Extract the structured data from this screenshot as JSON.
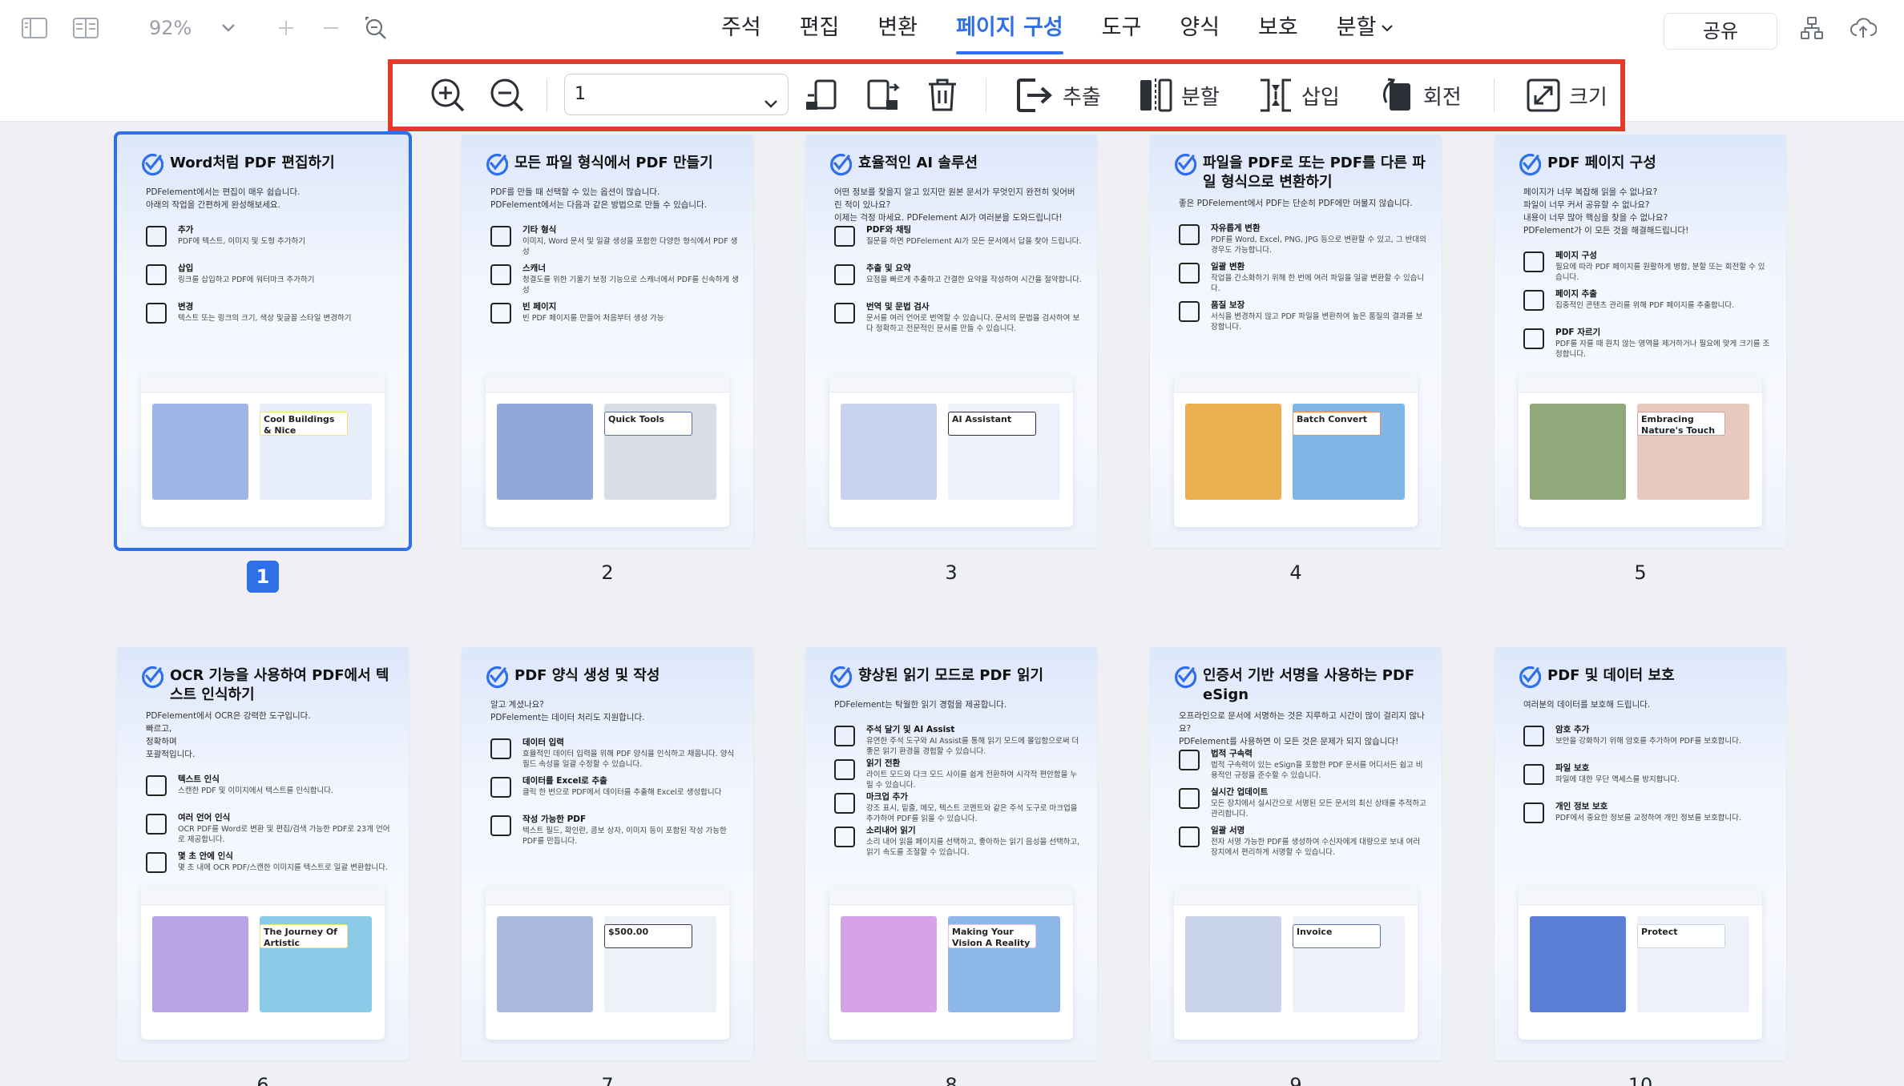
{
  "header": {
    "zoom": "92%",
    "menu": [
      {
        "label": "주석"
      },
      {
        "label": "편집"
      },
      {
        "label": "변환"
      },
      {
        "label": "페이지 구성"
      },
      {
        "label": "도구"
      },
      {
        "label": "양식"
      },
      {
        "label": "보호"
      },
      {
        "label": "분할"
      }
    ],
    "active_menu": "페이지 구성",
    "share_label": "공유"
  },
  "toolbar": {
    "page_value": "1",
    "extract_label": "추출",
    "split_label": "분할",
    "insert_label": "삽입",
    "rotate_label": "회전",
    "size_label": "크기"
  },
  "pages": [
    {
      "number": "1",
      "selected": true,
      "title": "Word처럼 PDF 편집하기",
      "intro": "PDFelement에서는 편집이 매우 쉽습니다.\n아래의 작업을 간편하게 완성해보세요.",
      "features": [
        {
          "name": "추가",
          "desc": "PDF에 텍스트, 이미지 및 도형 추가하기"
        },
        {
          "name": "삽입",
          "desc": "링크를 삽입하고 PDF에 워터마크 추가하기"
        },
        {
          "name": "변경",
          "desc": "텍스트 또는 링크의 크기, 색상 및글꼴 스타일 변경하기"
        }
      ],
      "mock_text": "Cool Buildings & Nice Gradients"
    },
    {
      "number": "2",
      "selected": false,
      "title": "모든 파일 형식에서 PDF 만들기",
      "intro": "PDF를 만들 때 선택할 수 있는 옵션이 많습니다.\nPDFelement에서는 다음과 같은 방법으로 만들 수 있습니다.",
      "features": [
        {
          "name": "기타 형식",
          "desc": "이미지, Word 문서 및 일괄 생성을 포함한 다양한 형식에서 PDF 생성"
        },
        {
          "name": "스캐너",
          "desc": "청결도를 위한 기울기 보정 기능으로 스캐너에서 PDF를 신속하게 생성"
        },
        {
          "name": "빈 페이지",
          "desc": "빈 PDF 페이지를 만들어 처음부터 생성 가능"
        }
      ],
      "mock_text": "Quick Tools"
    },
    {
      "number": "3",
      "selected": false,
      "title": "효율적인 AI 솔루션",
      "intro": "어떤 정보를 찾을지 알고 있지만 원본 문서가 무엇인지 완전히 잊어버린 적이 있나요?\n이제는 걱정 마세요. PDFelement AI가 여러분을 도와드립니다!",
      "features": [
        {
          "name": "PDF와 채팅",
          "desc": "질문을 하면 PDFelement AI가 모든 문서에서 답을 찾아 드립니다."
        },
        {
          "name": "추출 및 요약",
          "desc": "요점을 빠르게 추출하고 간결한 요약을 작성하여 시간을 절약합니다."
        },
        {
          "name": "번역 및 문법 검사",
          "desc": "문서를 여러 언어로 번역할 수 있습니다. 문서의 문법을 검사하여 보다 정확하고 전문적인 문서를 만들 수 있습니다."
        }
      ],
      "mock_text": "AI Assistant"
    },
    {
      "number": "4",
      "selected": false,
      "title": "파일을 PDF로 또는 PDF를 다른 파일 형식으로 변환하기",
      "intro": "좋은 PDFelement에서 PDF는 단순히 PDF에만 머물지 않습니다.",
      "features": [
        {
          "name": "자유롭게 변환",
          "desc": "PDF를 Word, Excel, PNG, JPG 등으로 변환할 수 있고, 그 반대의 경우도 가능합니다."
        },
        {
          "name": "일괄 변환",
          "desc": "작업을 간소화하기 위해 한 번에 여러 파일을 일괄 변환할 수 있습니다."
        },
        {
          "name": "품질 보장",
          "desc": "서식을 변경하지 않고 PDF 파일을 변환하여 높은 품질의 결과를 보장합니다."
        }
      ],
      "mock_text": "Batch Convert"
    },
    {
      "number": "5",
      "selected": false,
      "title": "PDF 페이지 구성",
      "intro": "페이지가 너무 복잡해 읽을 수 없나요?\n파일이 너무 커서 공유할 수 없나요?\n내용이 너무 많아 핵심을 찾을 수 없나요?\nPDFelement가 이 모든 것을 해결해드립니다!",
      "features": [
        {
          "name": "페이지 구성",
          "desc": "필요에 따라 PDF 페이지를 원활하게 병합, 분할 또는 회전할 수 있습니다."
        },
        {
          "name": "페이지 추출",
          "desc": "집중적인 콘텐츠 관리를 위해 PDF 페이지를 추출합니다."
        },
        {
          "name": "PDF 자르기",
          "desc": "PDF를 자를 때 원치 않는 영역을 제거하거나 필요에 맞게 크기를 조정합니다."
        }
      ],
      "mock_text": "Embracing Nature's Touch"
    },
    {
      "number": "6",
      "selected": false,
      "title": "OCR 기능을 사용하여 PDF에서 텍스트 인식하기",
      "intro": "PDFelement에서 OCR은 강력한 도구입니다.\n빠르고,\n정확하며\n포괄적입니다.",
      "features": [
        {
          "name": "텍스트 인식",
          "desc": "스캔한 PDF 및 이미지에서 텍스트를 인식합니다."
        },
        {
          "name": "여러 언어 인식",
          "desc": "OCR PDF를 Word로 변환 및 편집/검색 가능한 PDF로 23개 언어로 제공합니다."
        },
        {
          "name": "몇 초 안에 인식",
          "desc": "몇 초 내에 OCR PDF/스캔한 이미지를 텍스트로 일괄 변환합니다."
        }
      ],
      "mock_text": "The Journey Of Artistic Creation"
    },
    {
      "number": "7",
      "selected": false,
      "title": "PDF 양식 생성 및 작성",
      "intro": "알고 계셨나요?\nPDFelement는 데이터 처리도 지원합니다.",
      "features": [
        {
          "name": "데이터 입력",
          "desc": "효율적인 데이터 입력을 위해 PDF 양식을 인식하고 채웁니다. 양식 필드 속성을 일괄 수정할 수 있습니다."
        },
        {
          "name": "데이터를 Excel로 추출",
          "desc": "클릭 한 번으로 PDF에서 데이터를 추출해 Excel로 생성합니다"
        },
        {
          "name": "작성 가능한 PDF",
          "desc": "텍스트 필드, 확인란, 콤보 상자, 이미지 등이 포함된 작성 가능한 PDF를 만듭니다."
        }
      ],
      "mock_text": "$500.00"
    },
    {
      "number": "8",
      "selected": false,
      "title": "향상된 읽기 모드로 PDF 읽기",
      "intro": "PDFelement는 탁월한 읽기 경험을 제공합니다.",
      "features": [
        {
          "name": "주석 달기 및 AI Assist",
          "desc": "유연한 주석 도구와 AI Assist를 통해 읽기 모드에 몰입함으로써 더 좋은 읽기 환경을 경험할 수 있습니다."
        },
        {
          "name": "읽기 전환",
          "desc": "라이트 모드와 다크 모드 사이를 쉽게 전환하여 시각적 편안함을 누릴 수 있습니다."
        },
        {
          "name": "마크업 추가",
          "desc": "강조 표시, 밑줄, 메모, 텍스트 코멘트와 같은 주석 도구로 마크업을 추가하여 PDF를 읽을 수 있습니다."
        },
        {
          "name": "소리내어 읽기",
          "desc": "소리 내어 읽을 페이지를 선택하고, 좋아하는 읽기 음성을 선택하고, 읽기 속도를 조절할 수 있습니다."
        }
      ],
      "mock_text": "Making Your Vision A Reality"
    },
    {
      "number": "9",
      "selected": false,
      "title": "인증서 기반 서명을 사용하는 PDF eSign",
      "intro": "오프라인으로 문서에 서명하는 것은 지루하고 시간이 많이 걸리지 않나요?\nPDFelement를 사용하면 이 모든 것은 문제가 되지 않습니다!",
      "features": [
        {
          "name": "법적 구속력",
          "desc": "법적 구속력이 있는 eSign을 포함한 PDF 문서를 어디서든 쉽고 비용적인 규정을 준수할 수 있습니다."
        },
        {
          "name": "실시간 업데이트",
          "desc": "모든 장치에서 실시간으로 서명된 모든 문서의 최신 상태를 추적하고 관리합니다."
        },
        {
          "name": "일괄 서명",
          "desc": "전자 서명 가능한 PDF를 생성하여 수신자에게 대량으로 보내 여러 장치에서 편리하게 서명할 수 있습니다."
        }
      ],
      "mock_text": "Invoice"
    },
    {
      "number": "10",
      "selected": false,
      "title": "PDF 및 데이터 보호",
      "intro": "여러분의 데이터를 보호해 드립니다.",
      "features": [
        {
          "name": "암호 추가",
          "desc": "보안을 강화하기 위해 암호를 추가하여 PDF를 보호합니다."
        },
        {
          "name": "파일 보호",
          "desc": "파일에 대한 무단 액세스를 방지합니다."
        },
        {
          "name": "개인 정보 보호",
          "desc": "PDF에서 중요한 정보를 교정하여 개인 정보를 보호합니다."
        }
      ],
      "mock_text": "Protect"
    }
  ],
  "colors": {
    "accent": "#2f6fe8",
    "highlight_border": "#e5392d"
  }
}
